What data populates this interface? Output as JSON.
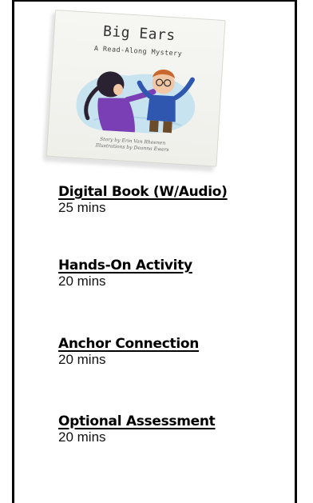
{
  "book": {
    "title": "Big Ears",
    "subtitle": "A Read-Along Mystery",
    "credit_story": "Story by Erin Van Rheenen",
    "credit_illustrations": "Illustrations by Deanna Ewers"
  },
  "activities": [
    {
      "title": "Digital Book (W/Audio)",
      "duration": "25  mins"
    },
    {
      "title": "Hands-On Activity",
      "duration": "20  mins"
    },
    {
      "title": "Anchor Connection",
      "duration": "20 mins"
    },
    {
      "title": "Optional Assessment",
      "duration": "20 mins"
    }
  ],
  "colors": {
    "border": "#000000",
    "background": "#ffffff",
    "girl_shirt": "#7b3fb5",
    "boy_shirt": "#2f57b0",
    "art_blob": "#bfe0f0"
  },
  "icons": {
    "cover_illustration": "two-children-illustration"
  }
}
